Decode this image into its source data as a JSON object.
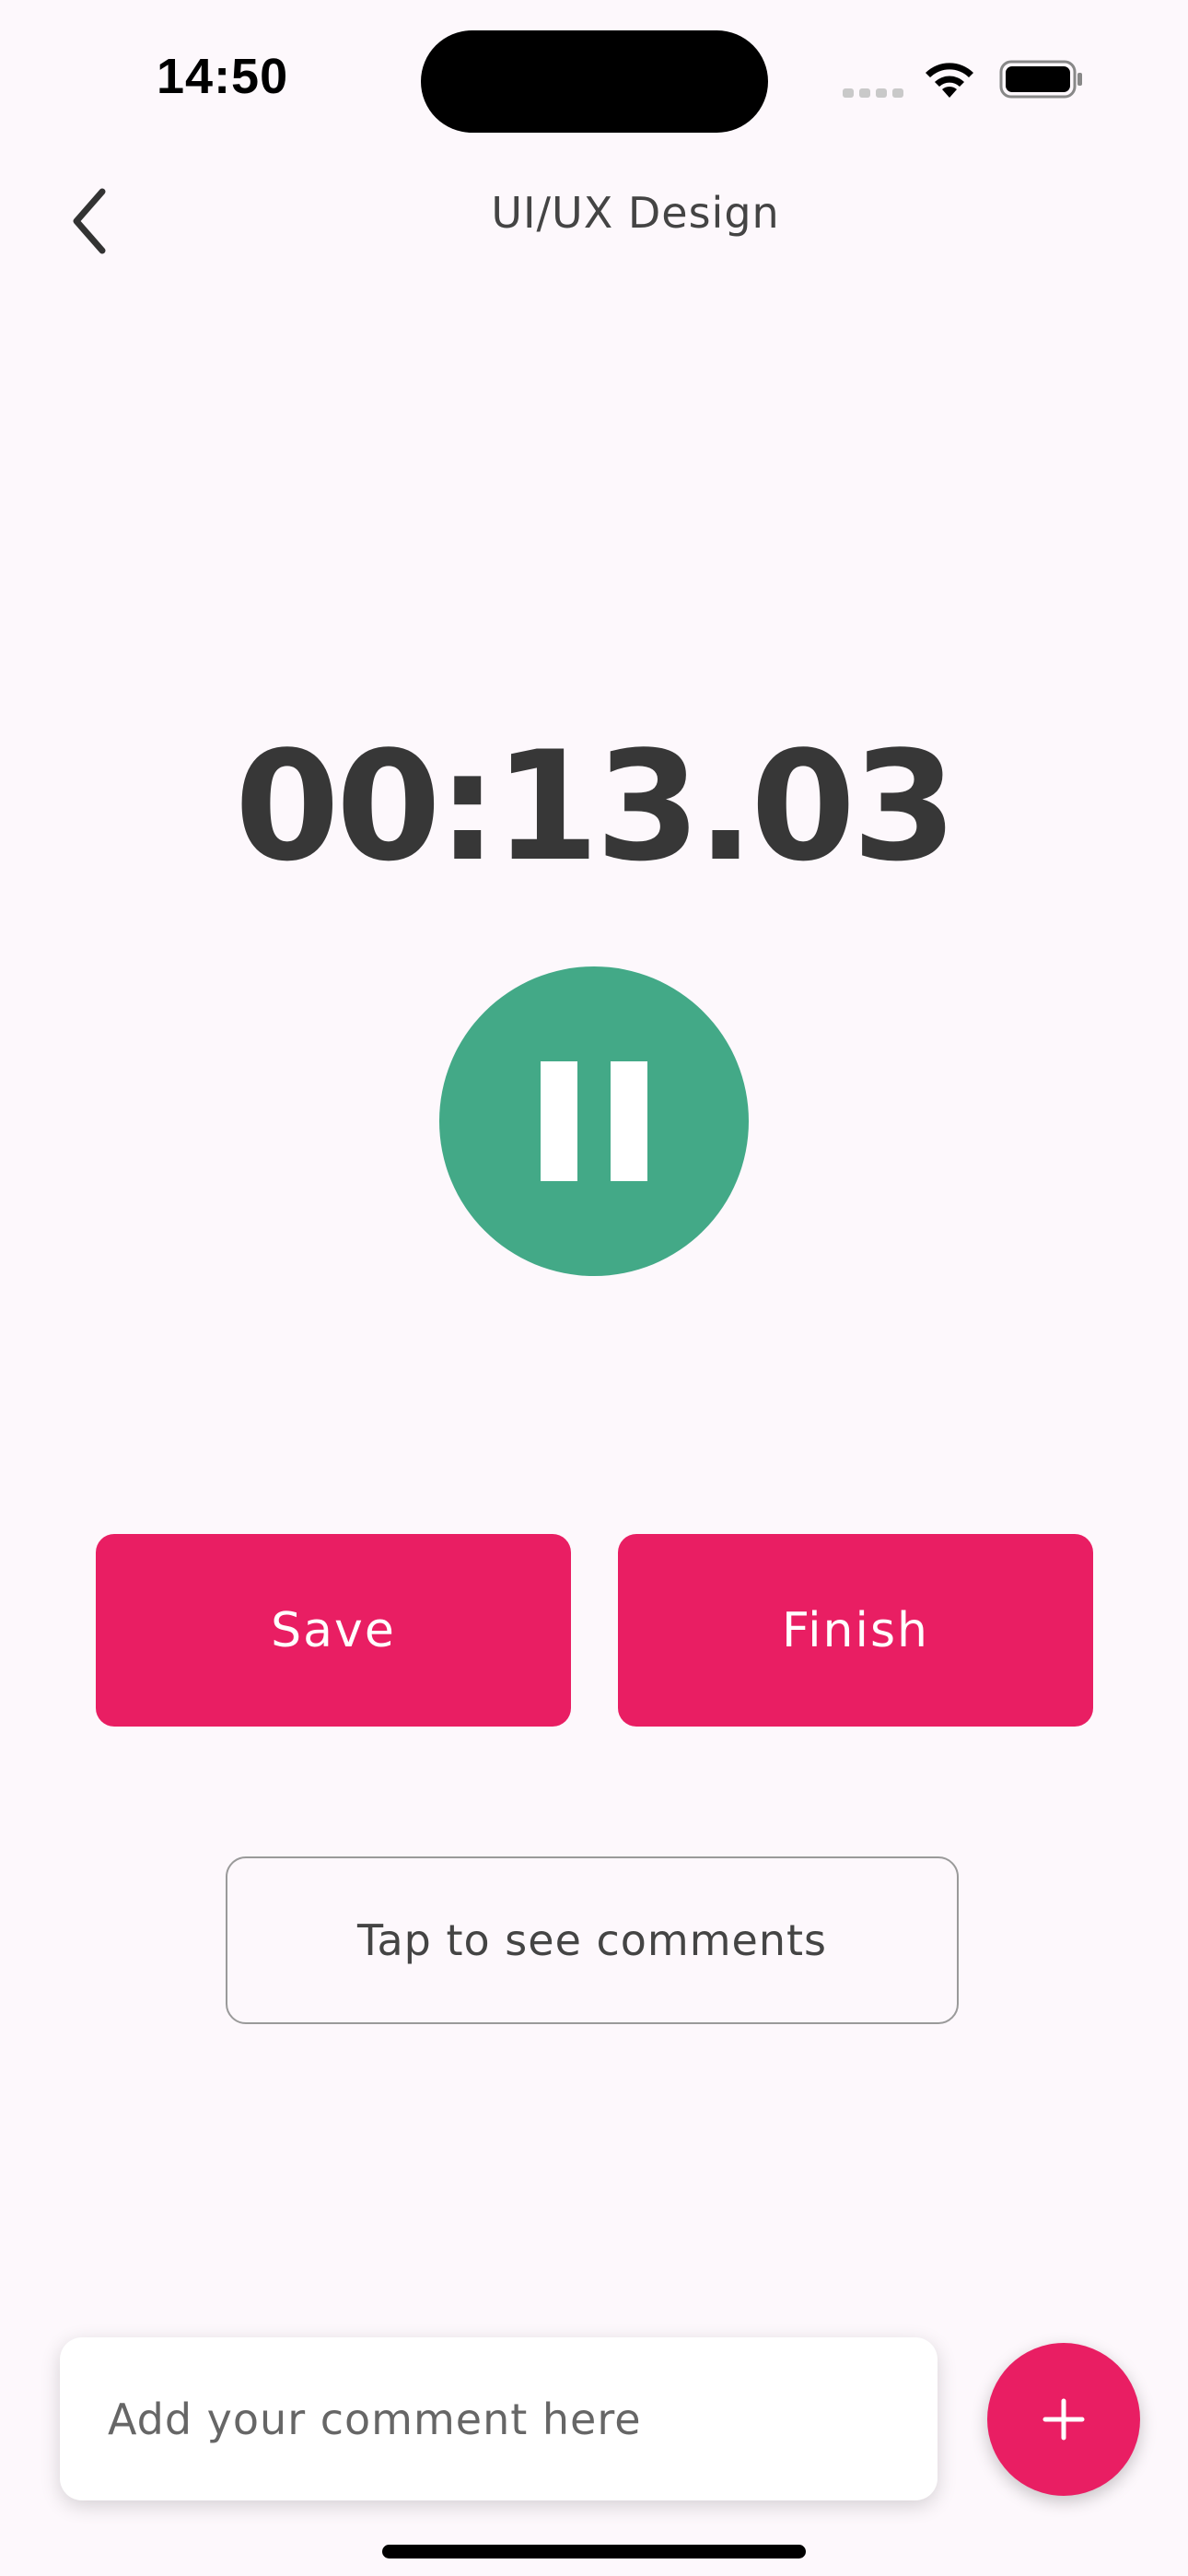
{
  "status_bar": {
    "time": "14:50"
  },
  "header": {
    "back_icon": "chevron-left-icon",
    "title": "UI/UX Design"
  },
  "timer": {
    "display": "00:13.03",
    "pause_icon": "pause-icon",
    "pause_color": "#43a987"
  },
  "actions": {
    "save_label": "Save",
    "finish_label": "Finish",
    "accent_color": "#e91e63"
  },
  "comments": {
    "toggle_label": "Tap to see comments",
    "input_placeholder": "Add your comment here",
    "input_value": "",
    "add_icon": "plus-icon"
  }
}
